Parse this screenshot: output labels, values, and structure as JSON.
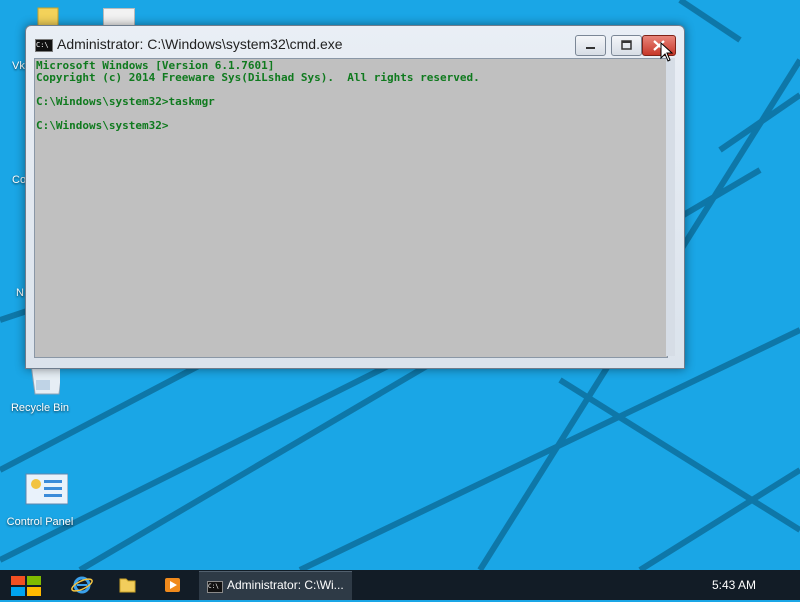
{
  "colors": {
    "desktop_bg": "#1aa6e6",
    "console_bg": "#c0c0c0",
    "console_text": "#0f7a1e",
    "taskbar_bg": "#121c26",
    "close_button": "#c7382a"
  },
  "desktop": {
    "icons": [
      {
        "label": "Vk",
        "icon": "folder-icon"
      },
      {
        "label": "Co",
        "icon": "computer-icon"
      },
      {
        "label": "N",
        "icon": "network-icon"
      },
      {
        "label": "Recycle Bin",
        "icon": "recycle-bin-icon"
      },
      {
        "label": "Control Panel",
        "icon": "control-panel-icon"
      }
    ]
  },
  "window": {
    "title": "Administrator: C:\\Windows\\system32\\cmd.exe",
    "icon_text": "C:\\",
    "buttons": {
      "minimize": "minimize-icon",
      "maximize": "maximize-icon",
      "close": "close-icon"
    },
    "console_lines": [
      "Microsoft Windows [Version 6.1.7601]",
      "Copyright (c) 2014 Freeware Sys(DiLshad Sys).  All rights reserved.",
      "",
      "C:\\Windows\\system32>taskmgr",
      "",
      "C:\\Windows\\system32>"
    ]
  },
  "taskbar": {
    "start": "windows-logo-icon",
    "pinned": [
      "internet-explorer-icon",
      "file-explorer-icon",
      "media-player-icon"
    ],
    "active_task_label": "Administrator: C:\\Wi...",
    "active_task_icon_text": "C:\\",
    "clock": "5:43 AM"
  }
}
